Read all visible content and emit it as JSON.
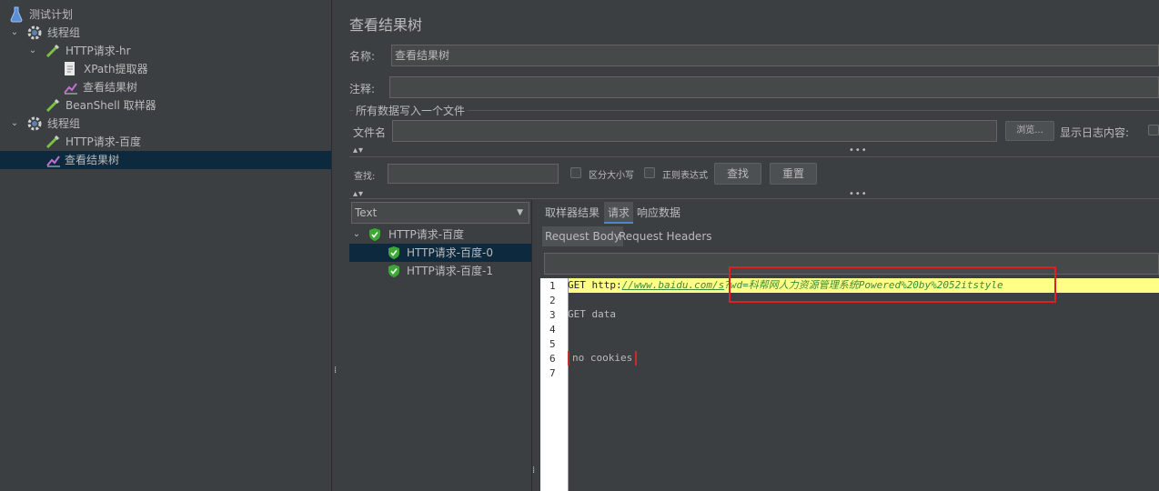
{
  "tree": {
    "items": [
      {
        "label": "测试计划"
      },
      {
        "label": "线程组"
      },
      {
        "label": "HTTP请求-hr"
      },
      {
        "label": "XPath提取器"
      },
      {
        "label": "查看结果树"
      },
      {
        "label": "BeanShell 取样器"
      },
      {
        "label": "线程组"
      },
      {
        "label": "HTTP请求-百度"
      },
      {
        "label": "查看结果树"
      }
    ]
  },
  "panel": {
    "title": "查看结果树",
    "name_label": "名称:",
    "name_value": "查看结果树",
    "comment_label": "注释:",
    "comment_value": "",
    "file_group_label": "所有数据写入一个文件",
    "filename_label": "文件名",
    "filename_value": "",
    "browse_label": "浏览...",
    "log_content_label": "显示日志内容:"
  },
  "search": {
    "label": "查找:",
    "value": "",
    "case_label": "区分大小写",
    "regex_label": "正则表达式",
    "find_button": "查找",
    "reset_button": "重置"
  },
  "results": {
    "renderer": "Text",
    "parent": "HTTP请求-百度",
    "children": [
      "HTTP请求-百度-0",
      "HTTP请求-百度-1"
    ]
  },
  "tabs": {
    "main": [
      "取样器结果",
      "请求",
      "响应数据"
    ],
    "active_main": "请求",
    "sub": [
      "Request Body",
      "Request Headers"
    ],
    "active_sub": "Request Body"
  },
  "editor": {
    "line_numbers": [
      "1",
      "2",
      "3",
      "4",
      "5",
      "6",
      "7"
    ],
    "line1_method": "GET ",
    "line1_scheme": "http:",
    "line1_url": "//www.baidu.com/s",
    "line1_query": "?wd=科帮网人力资源管理系统Powered%20by%2052itstyle",
    "line3": "GET data",
    "line6": "no cookies"
  },
  "colors": {
    "bg": "#3c3f41",
    "selection": "#0d293e",
    "highlight_line": "#ffff88",
    "annotation_box": "#e02020",
    "check_green": "#3aaa35"
  }
}
